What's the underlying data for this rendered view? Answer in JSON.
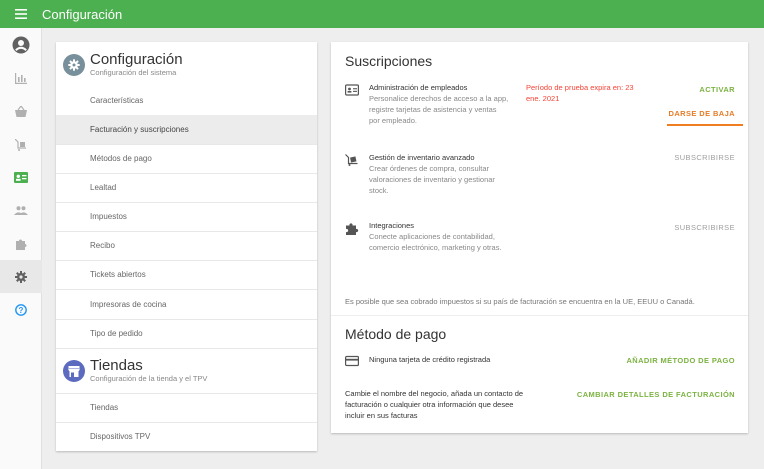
{
  "app": {
    "title": "Configuración"
  },
  "rail": {
    "icons": [
      "account-icon",
      "reports-icon",
      "items-icon",
      "inventory-icon",
      "employees-icon",
      "customers-icon",
      "integrations-icon",
      "settings-icon",
      "help-icon"
    ],
    "active": "settings-icon",
    "colors": {
      "default": "#b0b0b0",
      "green": "#4caf50",
      "blue": "#2196f3",
      "dark": "#616161"
    }
  },
  "config_section": {
    "title": "Configuración",
    "subtitle": "Configuración del sistema",
    "icon": "gear-icon",
    "icon_color": "#78909c",
    "items": [
      {
        "label": "Características"
      },
      {
        "label": "Facturación y suscripciones"
      },
      {
        "label": "Métodos de pago"
      },
      {
        "label": "Lealtad"
      },
      {
        "label": "Impuestos"
      },
      {
        "label": "Recibo"
      },
      {
        "label": "Tickets abiertos"
      },
      {
        "label": "Impresoras de cocina"
      },
      {
        "label": "Tipo de pedido"
      }
    ],
    "active_item": "Facturación y suscripciones"
  },
  "stores_section": {
    "title": "Tiendas",
    "subtitle": "Configuración de la tienda y el TPV",
    "icon": "store-icon",
    "icon_color": "#5c6bc0",
    "items": [
      {
        "label": "Tiendas"
      },
      {
        "label": "Dispositivos TPV"
      }
    ]
  },
  "subscriptions": {
    "title": "Suscripciones",
    "items": [
      {
        "icon": "employee-card-icon",
        "title": "Administración de empleados",
        "description": "Personalice derechos de acceso a la app, registre tarjetas de asistencia y ventas por empleado.",
        "trial": "Período de prueba expira en: 23 ene. 2021",
        "primary_action": "ACTIVAR",
        "secondary_action": "DARSE DE BAJA"
      },
      {
        "icon": "inventory-cart-icon",
        "title": "Gestión de inventario avanzado",
        "description": "Crear órdenes de compra, consultar valoraciones de inventario y gestionar stock.",
        "action": "SUBSCRIBIRSE"
      },
      {
        "icon": "puzzle-icon",
        "title": "Integraciones",
        "description": "Conecte aplicaciones de contabilidad, comercio electrónico, marketing y otras.",
        "action": "SUBSCRIBIRSE"
      }
    ],
    "tax_note": "Es posible que sea cobrado impuestos si su país de facturación se encuentra en la UE, EEUU o Canadá."
  },
  "payment": {
    "title": "Método de pago",
    "card_text": "Ninguna tarjeta de crédito registrada",
    "add_action": "AÑADIR MÉTODO DE PAGO",
    "billing_text": "Cambie el nombre del negocio, añada un contacto de facturación o cualquier otra información que desee incluir en sus facturas",
    "billing_action": "CAMBIAR DETALLES DE FACTURACIÓN"
  },
  "colors": {
    "brand": "#4caf50",
    "action_green": "#7cb342",
    "action_orange": "#e57c27",
    "trial_red": "#f44336"
  }
}
